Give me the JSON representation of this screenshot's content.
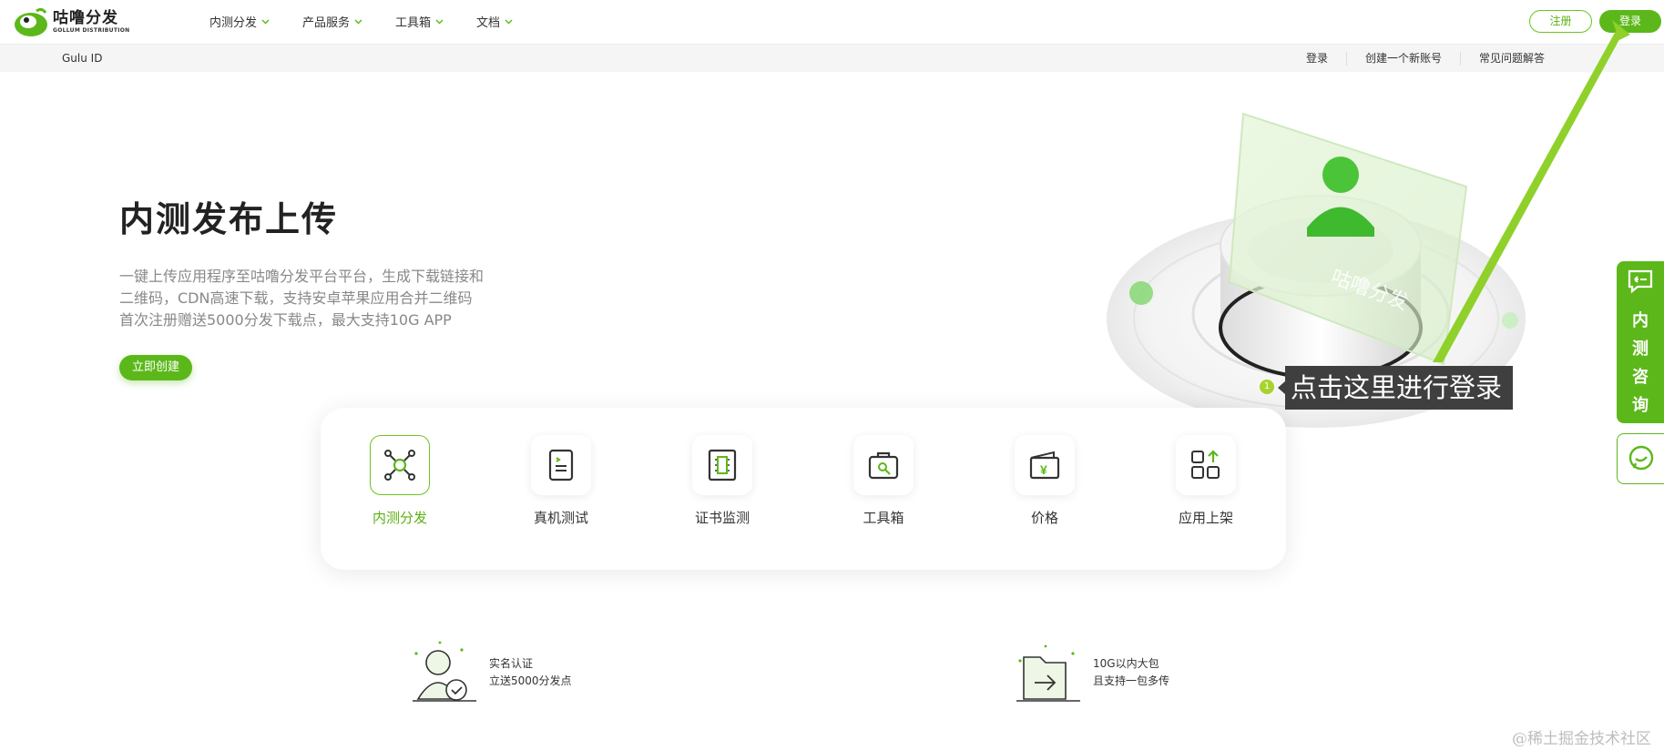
{
  "brand": {
    "name_cn": "咕噜分发",
    "name_en": "GOLLUM DISTRIBUTION",
    "accent": "#5cb81a"
  },
  "nav": {
    "items": [
      {
        "label": "内测分发",
        "icon": "chevron-down-icon"
      },
      {
        "label": "产品服务",
        "icon": "chevron-down-icon"
      },
      {
        "label": "工具箱",
        "icon": "chevron-down-icon"
      },
      {
        "label": "文档",
        "icon": "chevron-down-icon"
      }
    ],
    "register_label": "注册",
    "login_label": "登录"
  },
  "subbar": {
    "title": "Gulu ID",
    "links": [
      "登录",
      "创建一个新账号",
      "常见问题解答"
    ]
  },
  "hero": {
    "title": "内测发布上传",
    "desc_lines": [
      "一键上传应用程序至咕噜分发平台平台，生成下载链接和",
      "二维码，CDN高速下载，支持安卓苹果应用合并二维码",
      "首次注册赠送5000分发下载点，最大支持10G APP"
    ],
    "cta_label": "立即创建",
    "art_text": "咕噜分发"
  },
  "features": [
    {
      "label": "内测分发",
      "icon": "network-icon",
      "active": true
    },
    {
      "label": "真机测试",
      "icon": "phone-test-icon",
      "active": false
    },
    {
      "label": "证书监测",
      "icon": "certificate-icon",
      "active": false
    },
    {
      "label": "工具箱",
      "icon": "toolbox-icon",
      "active": false
    },
    {
      "label": "价格",
      "icon": "wallet-yen-icon",
      "active": false
    },
    {
      "label": "应用上架",
      "icon": "apps-upload-icon",
      "active": false
    }
  ],
  "benefits": [
    {
      "line1": "实名认证",
      "line2": "立送5000分发点",
      "icon": "verified-user-icon"
    },
    {
      "line1": "10G以内大包",
      "line2": "且支持一包多传",
      "icon": "folder-upload-icon"
    }
  ],
  "callout": {
    "step": "1",
    "text": "点击这里进行登录"
  },
  "float": {
    "consult_chars": [
      "内",
      "测",
      "咨",
      "询"
    ],
    "consult_icon": "message-icon",
    "chat_icon": "wechat-icon"
  },
  "watermark": "@稀土掘金技术社区"
}
